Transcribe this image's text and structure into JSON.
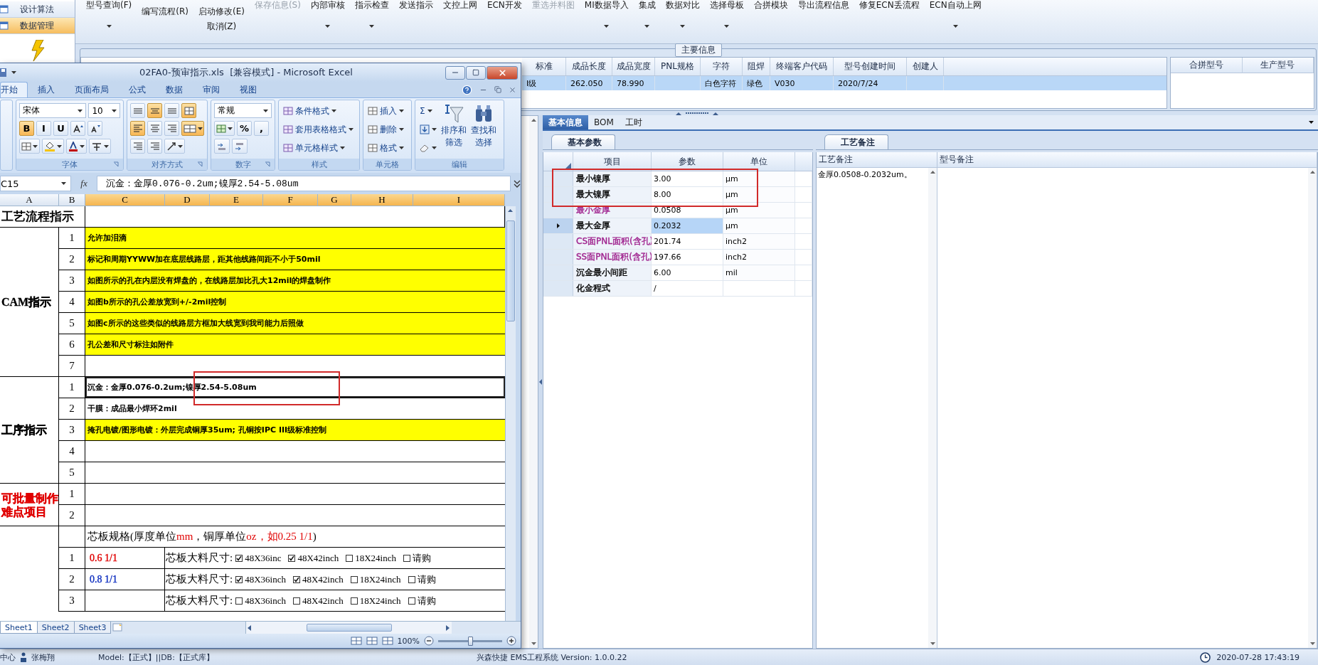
{
  "sidebar": {
    "items": [
      {
        "label": "设计算法",
        "selected": false
      },
      {
        "label": "数据管理",
        "selected": true
      }
    ]
  },
  "toolbar": {
    "groups": [
      {
        "kind": "tall",
        "dropdown": true,
        "items": [
          {
            "label": "型号查询(F)",
            "disabled": false
          }
        ]
      },
      {
        "kind": "stack",
        "dropdown": false,
        "items": [
          {
            "label": "编写流程(R)",
            "disabled": false
          }
        ]
      },
      {
        "kind": "stack",
        "dropdown": false,
        "items": [
          {
            "label": "启动修改(E)",
            "disabled": false
          },
          {
            "label": "取消(Z)",
            "disabled": false
          }
        ]
      },
      {
        "kind": "tall",
        "dropdown": false,
        "items": [
          {
            "label": "保存信息(S)",
            "disabled": true
          }
        ]
      },
      {
        "kind": "tall",
        "dropdown": true,
        "items": [
          {
            "label": "内部审核",
            "disabled": false
          }
        ]
      },
      {
        "kind": "tall",
        "dropdown": true,
        "items": [
          {
            "label": "指示检查",
            "disabled": false
          }
        ]
      },
      {
        "kind": "tall",
        "dropdown": false,
        "items": [
          {
            "label": "发送指示",
            "disabled": false
          }
        ]
      },
      {
        "kind": "tall",
        "dropdown": false,
        "items": [
          {
            "label": "文控上网",
            "disabled": false
          }
        ]
      },
      {
        "kind": "tall",
        "dropdown": false,
        "items": [
          {
            "label": "ECN开发",
            "disabled": false
          }
        ]
      },
      {
        "kind": "tall",
        "dropdown": false,
        "items": [
          {
            "label": "重选并料图",
            "disabled": true
          }
        ]
      },
      {
        "kind": "tall",
        "dropdown": true,
        "items": [
          {
            "label": "MI数据导入",
            "disabled": false
          }
        ]
      },
      {
        "kind": "tall",
        "dropdown": true,
        "items": [
          {
            "label": "集成",
            "disabled": false
          }
        ]
      },
      {
        "kind": "tall",
        "dropdown": true,
        "items": [
          {
            "label": "数据对比",
            "disabled": false
          }
        ]
      },
      {
        "kind": "tall",
        "dropdown": true,
        "items": [
          {
            "label": "选择母板",
            "disabled": false
          }
        ]
      },
      {
        "kind": "tall",
        "dropdown": false,
        "items": [
          {
            "label": "合拼模块",
            "disabled": false
          }
        ]
      },
      {
        "kind": "tall",
        "dropdown": false,
        "items": [
          {
            "label": "导出流程信息",
            "disabled": false
          }
        ]
      },
      {
        "kind": "tall",
        "dropdown": false,
        "items": [
          {
            "label": "修复ECN丢流程",
            "disabled": false
          }
        ]
      },
      {
        "kind": "tall",
        "dropdown": true,
        "items": [
          {
            "label": "ECN自动上网",
            "disabled": false
          }
        ]
      }
    ]
  },
  "main_info": {
    "title": "主要信息",
    "columns": [
      "标准",
      "成品长度",
      "成品宽度",
      "PNL规格",
      "字符",
      "阻焊",
      "终端客户代码",
      "型号创建时间",
      "创建人"
    ],
    "rows": [
      {
        "selected": true,
        "cells": [
          "I级",
          "262.050",
          "78.990",
          null,
          "白色字符",
          "绿色",
          "V030",
          "2020/7/24",
          null
        ]
      }
    ],
    "side_columns": [
      "合拼型号",
      "生产型号"
    ]
  },
  "detail": {
    "tabs": [
      {
        "label": "基本信息",
        "selected": true
      },
      {
        "label": "BOM",
        "selected": false
      },
      {
        "label": "工时",
        "selected": false
      }
    ],
    "params": {
      "tab": "基本参数",
      "columns": [
        "项目",
        "参数",
        "单位"
      ],
      "rows": [
        {
          "item": "最小镍厚",
          "value": "3.00",
          "unit": "μm",
          "color": "#000000",
          "selected": false
        },
        {
          "item": "最大镍厚",
          "value": "8.00",
          "unit": "μm",
          "color": "#000000",
          "selected": false
        },
        {
          "item": "最小金厚",
          "value": "0.0508",
          "unit": "μm",
          "color": "#a0248f",
          "selected": false
        },
        {
          "item": "最大金厚",
          "value": "0.2032",
          "unit": "μm",
          "color": "#000000",
          "selected": true
        },
        {
          "item": "CS面PNL面积(含孔)",
          "value": "201.74",
          "unit": "inch2",
          "color": "#a0248f",
          "selected": false
        },
        {
          "item": "SS面PNL面积(含孔)",
          "value": "197.66",
          "unit": "inch2",
          "color": "#a0248f",
          "selected": false
        },
        {
          "item": "沉金最小间距",
          "value": "6.00",
          "unit": "mil",
          "color": "#000000",
          "selected": false
        },
        {
          "item": "化金程式",
          "value": "/",
          "color": "#000000",
          "selected": false
        }
      ]
    },
    "remarks": {
      "tab": "工艺备注",
      "columns": [
        "工艺备注",
        "型号备注"
      ],
      "process_note": "金厚0.0508-0.2032um。"
    }
  },
  "excel": {
    "title": "02FA0-预审指示.xls  [兼容模式] - Microsoft Excel",
    "tabs": [
      {
        "label": "开始",
        "selected": true
      },
      {
        "label": "插入",
        "selected": false
      },
      {
        "label": "页面布局",
        "selected": false
      },
      {
        "label": "公式",
        "selected": false
      },
      {
        "label": "数据",
        "selected": false
      },
      {
        "label": "审阅",
        "selected": false
      },
      {
        "label": "视图",
        "selected": false
      }
    ],
    "ribbon": {
      "font_name": "宋体",
      "font_size": "10",
      "format_buttons": [
        {
          "label": "B",
          "on": true
        },
        {
          "label": "I",
          "on": false
        },
        {
          "label": "U",
          "on": false
        }
      ],
      "align_buttons": [
        {
          "kind": "top",
          "on": false
        },
        {
          "kind": "middle",
          "on": true
        },
        {
          "kind": "bottom",
          "on": false
        },
        {
          "kind": "left",
          "on": true
        },
        {
          "kind": "center",
          "on": false
        },
        {
          "kind": "right",
          "on": false
        }
      ],
      "alignment": {
        "wrap_text": true,
        "merge": true
      },
      "number_format": "常规",
      "number_buttons": [
        "%",
        ","
      ],
      "style_buttons": [
        "条件格式",
        "套用表格格式",
        "单元格样式"
      ],
      "cell_buttons": [
        "插入",
        "删除",
        "格式"
      ],
      "sum_label": "Σ",
      "edit_buttons": [
        [
          "排序和",
          "筛选"
        ],
        [
          "查找和",
          "选择"
        ]
      ],
      "groups": [
        "字体",
        "对齐方式",
        "数字",
        "样式",
        "单元格",
        "编辑"
      ]
    },
    "name_box": "C15",
    "function_label": "fx",
    "formula": "沉金：金厚0.076-0.2um;镍厚2.54-5.08um",
    "columns": [
      {
        "label": "A",
        "selected": false
      },
      {
        "label": "B",
        "selected": false
      },
      {
        "label": "C",
        "selected": true
      },
      {
        "label": "D",
        "selected": true
      },
      {
        "label": "E",
        "selected": true
      },
      {
        "label": "F",
        "selected": true
      },
      {
        "label": "G",
        "selected": true
      },
      {
        "label": "H",
        "selected": true
      },
      {
        "label": "I",
        "selected": true
      }
    ],
    "sheet": {
      "sections": [
        {
          "kind": "title",
          "label": "工艺流程指示",
          "color": "#000000"
        },
        {
          "kind": "list",
          "label_lines": [
            "CAM指示"
          ],
          "color": "#000000",
          "rows": [
            {
              "no": "1",
              "text": "允许加泪滴",
              "highlight": true,
              "selected": false
            },
            {
              "no": "2",
              "text": "标记和周期YYWW加在底层线路层，距其他线路间距不小于50mil",
              "highlight": true,
              "selected": false
            },
            {
              "no": "3",
              "text": "如图所示的孔在内层没有焊盘的，在线路层加比孔大12mil的焊盘制作",
              "highlight": true,
              "selected": false
            },
            {
              "no": "4",
              "text": "如图b所示的孔公差放宽到+/-2mil控制",
              "highlight": true,
              "selected": false
            },
            {
              "no": "5",
              "text": "如图c所示的这些类似的线路层方框加大线宽到我司能力后照做",
              "highlight": true,
              "selected": false
            },
            {
              "no": "6",
              "text": "孔公差和尺寸标注如附件",
              "highlight": true,
              "selected": false
            },
            {
              "no": "7",
              "highlight": false,
              "selected": false
            }
          ]
        },
        {
          "kind": "list",
          "label_lines": [
            "工序指示"
          ],
          "color": "#000000",
          "rows": [
            {
              "no": "1",
              "text": "沉金：金厚0.076-0.2um;镍厚2.54-5.08um",
              "highlight": false,
              "selected": true
            },
            {
              "no": "2",
              "text": "干膜：成品最小焊环2mil",
              "highlight": false,
              "selected": false
            },
            {
              "no": "3",
              "text": "掩孔电镀/图形电镀：外层完成铜厚35um; 孔铜按IPC III级标准控制",
              "highlight": true,
              "selected": false
            },
            {
              "no": "4",
              "highlight": false,
              "selected": false
            },
            {
              "no": "5",
              "highlight": false,
              "selected": false
            }
          ]
        },
        {
          "kind": "list",
          "label_lines": [
            "可批量制作",
            "难点项目"
          ],
          "color": "#e00000",
          "rows": [
            {
              "no": "1",
              "highlight": false,
              "selected": false
            },
            {
              "no": "2",
              "highlight": false,
              "selected": false
            }
          ]
        },
        {
          "kind": "spec",
          "header": [
            {
              "text": "芯板规格(厚度单位",
              "color": "#000000"
            },
            {
              "text": "mm",
              "color": "#e00000"
            },
            {
              "text": "，铜厚单位",
              "color": "#000000"
            },
            {
              "text": "oz，如0.25 1/1",
              "color": "#e00000"
            },
            {
              "text": ")",
              "color": "#000000"
            }
          ],
          "rows": [
            {
              "no": "1",
              "value": "0.6 1/1",
              "color": "#e00000",
              "size_label": "芯板大料尺寸:",
              "options": [
                {
                  "label": "48X36inc",
                  "checked": true
                },
                {
                  "label": "48X42inch",
                  "checked": true
                },
                {
                  "label": "18X24inch",
                  "checked": false
                },
                {
                  "label": "请购",
                  "checked": false
                }
              ]
            },
            {
              "no": "2",
              "value": "0.8 1/1",
              "color": "#1030c0",
              "size_label": "芯板大料尺寸:",
              "options": [
                {
                  "label": "48X36inch",
                  "checked": true
                },
                {
                  "label": "48X42inch",
                  "checked": true
                },
                {
                  "label": "18X24inch",
                  "checked": false
                },
                {
                  "label": "请购",
                  "checked": false
                }
              ]
            },
            {
              "no": "3",
              "size_label": "芯板大料尺寸:",
              "options": [
                {
                  "label": "48X36inch",
                  "checked": false
                },
                {
                  "label": "48X42inch",
                  "checked": false
                },
                {
                  "label": "18X24inch",
                  "checked": false
                },
                {
                  "label": "请购",
                  "checked": false
                }
              ]
            }
          ]
        }
      ]
    },
    "sheets": [
      {
        "label": "Sheet1",
        "selected": true
      },
      {
        "label": "Sheet2",
        "selected": false
      },
      {
        "label": "Sheet3",
        "selected": false
      }
    ],
    "zoom": {
      "reading": "100%",
      "level": 0.5
    }
  },
  "status": {
    "location": "中心",
    "user": "张梅翔",
    "model": "Model:【正式】||DB:【正式库】",
    "product": "兴森快捷 EMS工程系统 Version: 1.0.0.22",
    "datetime": "2020-07-28 17:43:19"
  }
}
